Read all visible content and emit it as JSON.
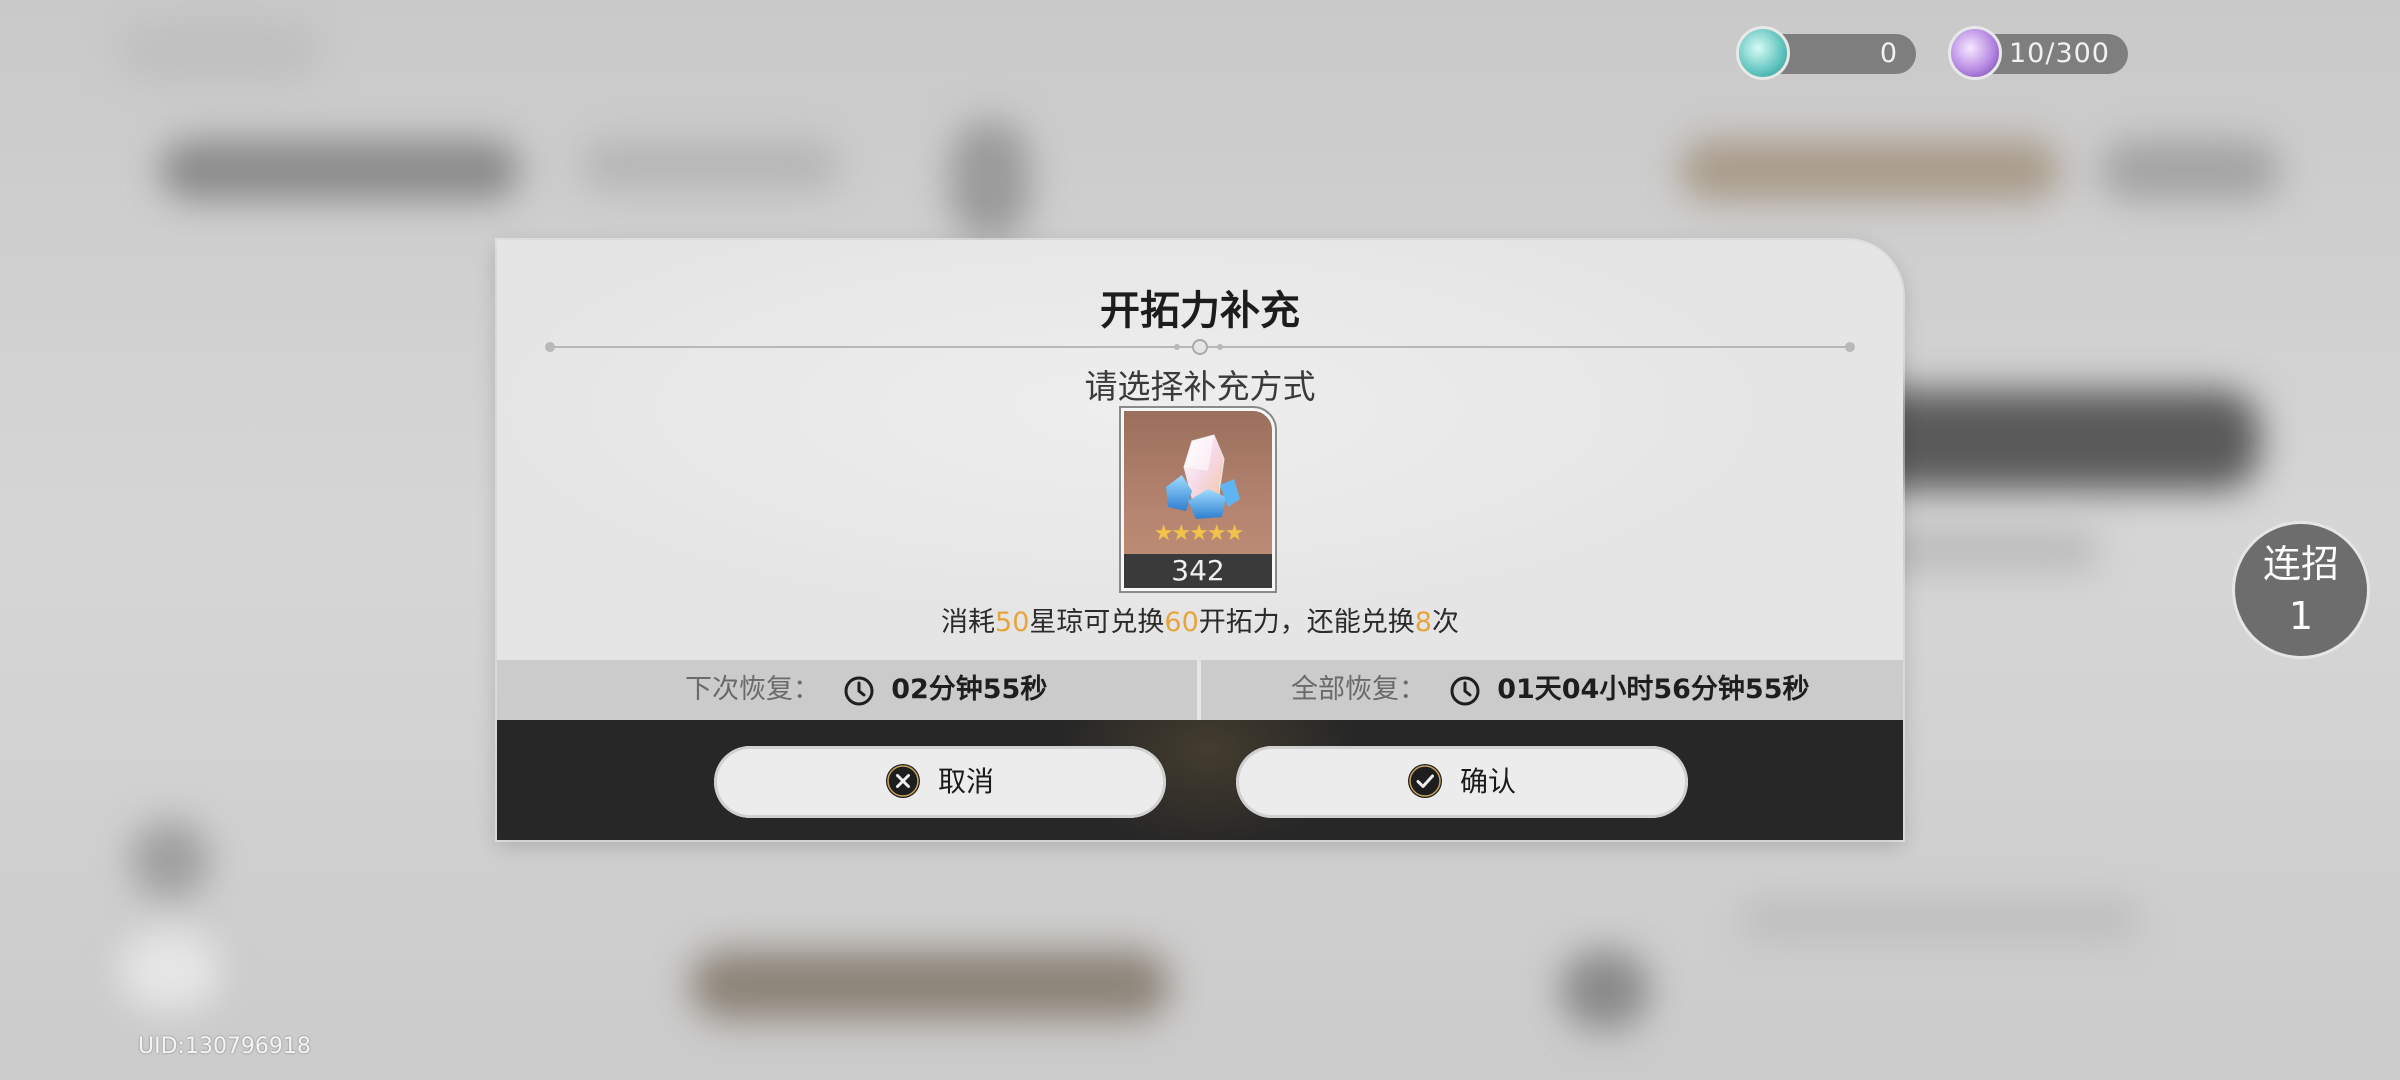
{
  "currencies": [
    {
      "name": "reserved-energy",
      "value": "0",
      "orb_color": "#7fd6d0"
    },
    {
      "name": "trailblaze-power",
      "value": "10/300",
      "orb_color": "#b48ae0"
    }
  ],
  "dialog": {
    "title": "开拓力补充",
    "subtitle": "请选择补充方式",
    "item": {
      "icon": "stellar-jade-icon",
      "stars": "★★★★★",
      "count": "342"
    },
    "description": {
      "prefix": "消耗",
      "cost": "50",
      "mid": "星琼可兑换",
      "gain": "60",
      "mid2": "开拓力，还能兑换",
      "times": "8",
      "suffix": "次"
    },
    "next_recover": {
      "label": "下次恢复：",
      "value": "02分钟55秒"
    },
    "full_recover": {
      "label": "全部恢复：",
      "value": "01天04小时56分钟55秒"
    },
    "buttons": {
      "cancel": "取消",
      "confirm": "确认"
    }
  },
  "combo": {
    "line1": "连招",
    "line2": "1"
  },
  "uid": "UID:130796918",
  "colors": {
    "highlight": "#e8a43c",
    "footer_bg": "#272727",
    "dialog_bg": "#e5e5e5"
  }
}
